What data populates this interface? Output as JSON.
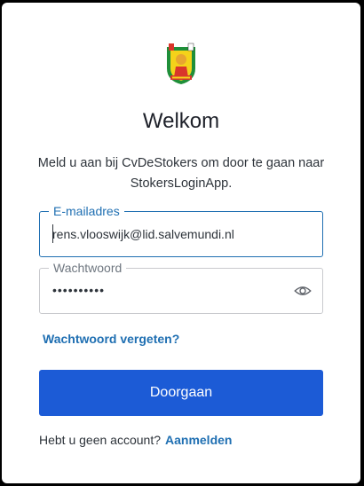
{
  "header": {
    "title": "Welkom",
    "subtitle": "Meld u aan bij CvDeStokers om door te gaan naar StokersLoginApp."
  },
  "logo": {
    "icon": "club-logo-icon",
    "accent": "#e8b400"
  },
  "form": {
    "email": {
      "label": "E-mailadres",
      "value": "rens.vlooswijk@lid.salvemundi.nl"
    },
    "password": {
      "label": "Wachtwoord",
      "masked_value": "••••••••••",
      "toggle_icon": "eye-icon"
    },
    "forgot_link": "Wachtwoord vergeten?",
    "submit_label": "Doorgaan"
  },
  "footer": {
    "prompt": "Hebt u geen account?",
    "signup_link": "Aanmelden"
  },
  "colors": {
    "primary_button": "#1c5bd6",
    "link": "#1f6fb2",
    "focus_border": "#1f6fb2"
  }
}
